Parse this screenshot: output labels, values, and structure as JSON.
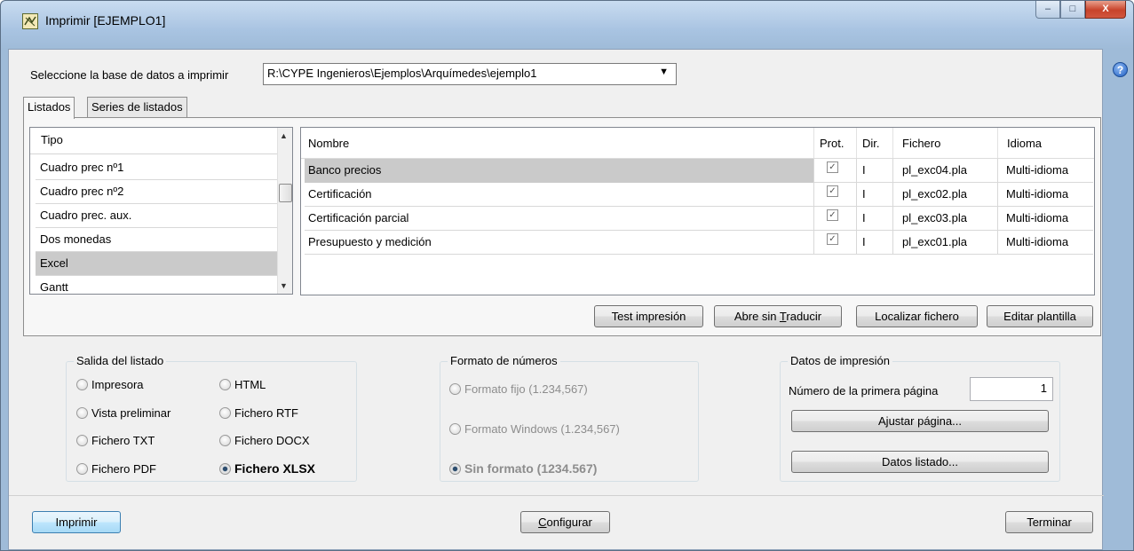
{
  "window": {
    "title": "Imprimir [EJEMPLO1]",
    "controls": {
      "minimize": "–",
      "maximize": "□",
      "close": "X"
    }
  },
  "database": {
    "label": "Seleccione la base de datos a imprimir",
    "value": "R:\\CYPE Ingenieros\\Ejemplos\\Arquímedes\\ejemplo1"
  },
  "tabs": [
    {
      "label": "Listados",
      "active": true
    },
    {
      "label": "Series de listados",
      "active": false
    }
  ],
  "type_list": {
    "header": "Tipo",
    "items": [
      "Cuadro prec nº1",
      "Cuadro prec nº2",
      "Cuadro prec. aux.",
      "Dos monedas",
      "Excel",
      "Gantt"
    ],
    "selected": "Excel"
  },
  "listings_table": {
    "columns": [
      "Nombre",
      "Prot.",
      "Dir.",
      "Fichero",
      "Idioma"
    ],
    "rows": [
      {
        "name": "Banco precios",
        "prot": true,
        "dir": "I",
        "file": "pl_exc04.pla",
        "lang": "Multi-idioma",
        "selected": true
      },
      {
        "name": "Certificación",
        "prot": true,
        "dir": "I",
        "file": "pl_exc02.pla",
        "lang": "Multi-idioma",
        "selected": false
      },
      {
        "name": "Certificación parcial",
        "prot": true,
        "dir": "I",
        "file": "pl_exc03.pla",
        "lang": "Multi-idioma",
        "selected": false
      },
      {
        "name": "Presupuesto y medición",
        "prot": true,
        "dir": "I",
        "file": "pl_exc01.pla",
        "lang": "Multi-idioma",
        "selected": false
      }
    ]
  },
  "table_buttons": {
    "test": "Test impresión",
    "open_pre": "Abre sin ",
    "open_u": "T",
    "open_post": "raducir",
    "locate": "Localizar fichero",
    "edit": "Editar plantilla"
  },
  "output": {
    "title": "Salida del listado",
    "options": [
      "Impresora",
      "Vista preliminar",
      "Fichero TXT",
      "Fichero PDF",
      "HTML",
      "Fichero RTF",
      "Fichero DOCX",
      "Fichero XLSX"
    ],
    "selected": "Fichero XLSX"
  },
  "number_format": {
    "title": "Formato de números",
    "options": [
      "Formato fijo (1.234,567)",
      "Formato Windows (1.234,567)",
      "Sin formato (1234.567)"
    ],
    "selected": "Sin formato (1234.567)"
  },
  "print_data": {
    "title": "Datos de impresión",
    "first_page_label": "Número de la primera página",
    "first_page_value": "1",
    "adjust_button": "Ajustar página...",
    "data_button": "Datos listado..."
  },
  "footer": {
    "print": "Imprimir",
    "configure_u": "C",
    "configure_rest": "onfigurar",
    "finish": "Terminar"
  }
}
